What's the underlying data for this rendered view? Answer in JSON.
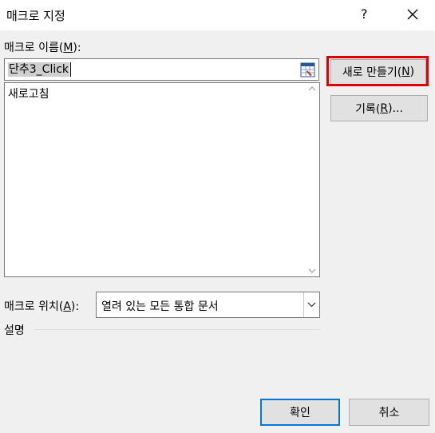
{
  "window": {
    "title": "매크로 지정",
    "help_glyph": "?",
    "close_icon": "close-icon"
  },
  "macro_name": {
    "label_prefix": "매크로 이름(",
    "label_access": "M",
    "label_suffix": "):",
    "value": "단추3_Click"
  },
  "macro_list": {
    "items": [
      "새로고침"
    ]
  },
  "buttons": {
    "new_prefix": "새로 만들기(",
    "new_access": "N",
    "new_suffix": ")",
    "record_prefix": "기록(",
    "record_access": "R",
    "record_suffix": ")...",
    "ok": "확인",
    "cancel": "취소"
  },
  "macro_location": {
    "label_prefix": "매크로 위치(",
    "label_access": "A",
    "label_suffix": "):",
    "value": "열려 있는 모든 통합 문서"
  },
  "description": {
    "label": "설명"
  },
  "colors": {
    "highlight": "#e00000",
    "default_button_border": "#0078d7"
  }
}
